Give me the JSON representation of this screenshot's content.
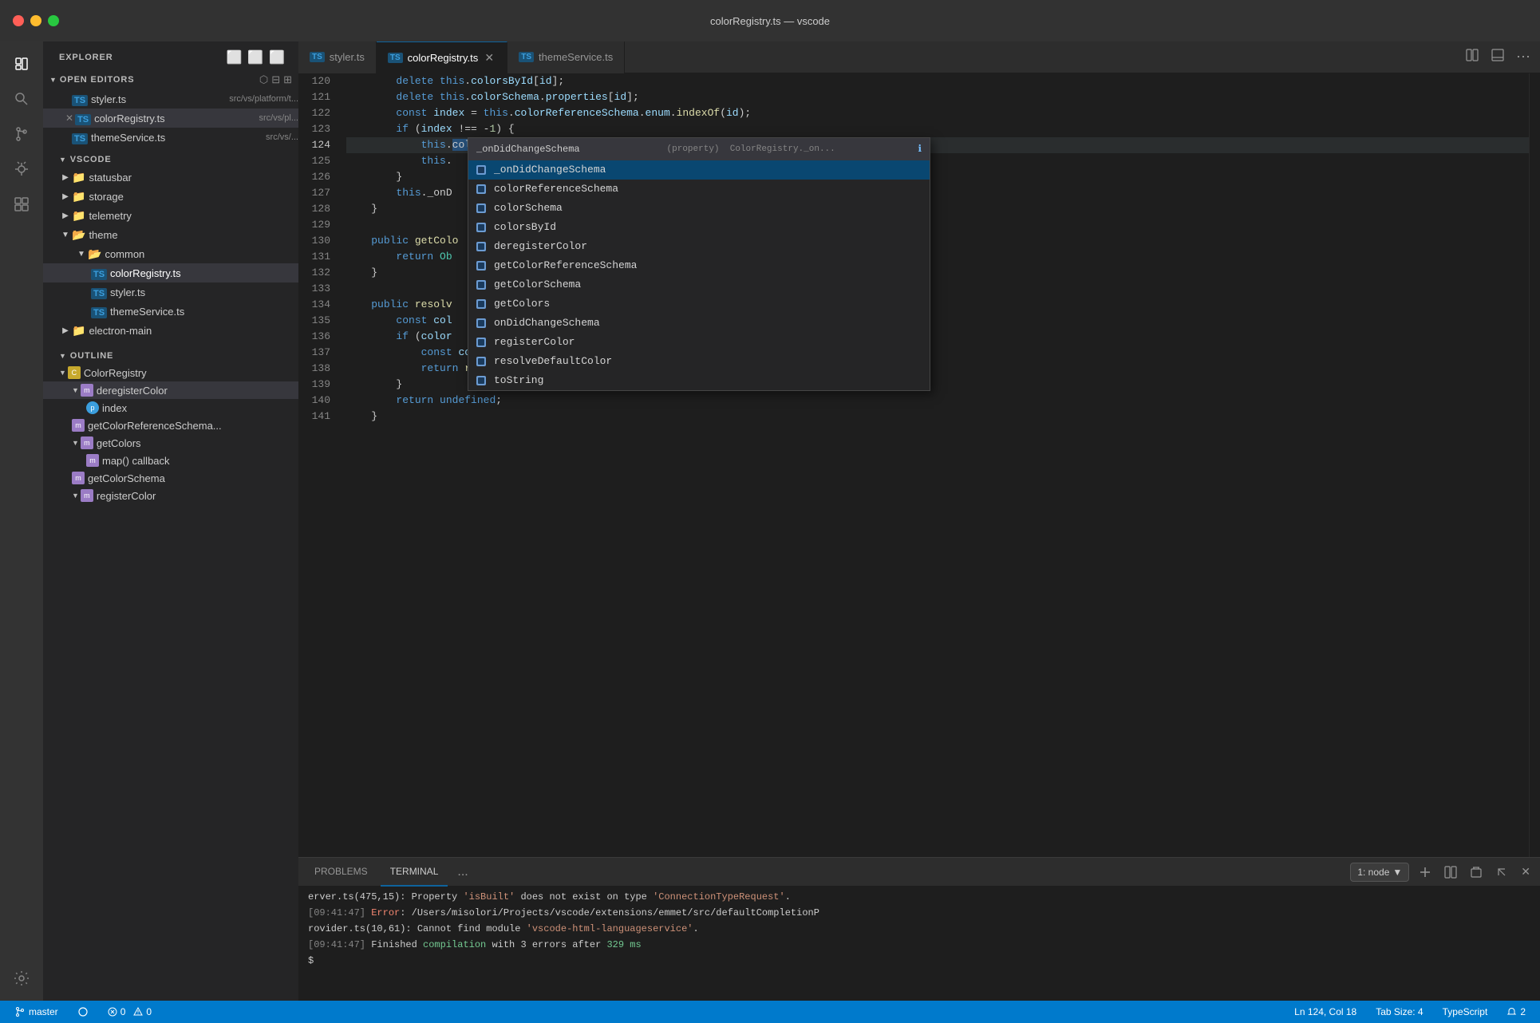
{
  "window": {
    "title": "colorRegistry.ts — vscode",
    "controls": {
      "close_label": "",
      "minimize_label": "",
      "maximize_label": ""
    }
  },
  "activity_bar": {
    "items": [
      {
        "name": "explorer",
        "icon": "⬜",
        "active": true
      },
      {
        "name": "search",
        "icon": "🔍"
      },
      {
        "name": "source-control",
        "icon": "⑂"
      },
      {
        "name": "debug",
        "icon": "🐛"
      },
      {
        "name": "extensions",
        "icon": "⧉"
      }
    ],
    "bottom": [
      {
        "name": "settings",
        "icon": "⚙"
      }
    ]
  },
  "sidebar": {
    "sections": {
      "open_editors": {
        "title": "OPEN EDITORS",
        "files": [
          {
            "name": "styler.ts",
            "path": "src/vs/platform/t...",
            "type": "ts",
            "active": false,
            "close": false
          },
          {
            "name": "colorRegistry.ts",
            "path": "src/vs/pl...",
            "type": "ts",
            "active": true,
            "close": true
          },
          {
            "name": "themeService.ts",
            "path": "src/vs/...",
            "type": "ts",
            "active": false,
            "close": false
          }
        ]
      },
      "vscode": {
        "title": "VSCODE",
        "tree": [
          {
            "name": "statusbar",
            "type": "folder",
            "depth": 1,
            "expanded": false
          },
          {
            "name": "storage",
            "type": "folder",
            "depth": 1,
            "expanded": false
          },
          {
            "name": "telemetry",
            "type": "folder",
            "depth": 1,
            "expanded": false
          },
          {
            "name": "theme",
            "type": "folder",
            "depth": 1,
            "expanded": true
          },
          {
            "name": "common",
            "type": "folder",
            "depth": 2,
            "expanded": true
          },
          {
            "name": "colorRegistry.ts",
            "type": "ts",
            "depth": 3,
            "active": true
          },
          {
            "name": "styler.ts",
            "type": "ts",
            "depth": 3
          },
          {
            "name": "themeService.ts",
            "type": "ts",
            "depth": 3
          },
          {
            "name": "electron-main",
            "type": "folder",
            "depth": 1,
            "expanded": false
          }
        ]
      },
      "outline": {
        "title": "OUTLINE",
        "items": [
          {
            "name": "ColorRegistry",
            "type": "class",
            "depth": 1,
            "expanded": true
          },
          {
            "name": "deregisterColor",
            "type": "method",
            "depth": 2,
            "expanded": true
          },
          {
            "name": "index",
            "type": "prop",
            "depth": 3
          },
          {
            "name": "getColorReferenceSchema...",
            "type": "method",
            "depth": 2
          },
          {
            "name": "getColors",
            "type": "method",
            "depth": 2,
            "expanded": true
          },
          {
            "name": "map() callback",
            "type": "method",
            "depth": 3
          },
          {
            "name": "getColorSchema",
            "type": "method",
            "depth": 2
          },
          {
            "name": "registerColor",
            "type": "method",
            "depth": 2,
            "expanded": true
          }
        ]
      }
    }
  },
  "tabs": [
    {
      "label": "styler.ts",
      "icon": "TS",
      "active": false,
      "modified": false
    },
    {
      "label": "colorRegistry.ts",
      "icon": "TS",
      "active": true,
      "modified": false
    },
    {
      "label": "themeService.ts",
      "icon": "TS",
      "active": false,
      "modified": false
    }
  ],
  "code": {
    "lines": [
      {
        "num": 120,
        "text": "        delete this.colorsById[id];"
      },
      {
        "num": 121,
        "text": "        delete this.colorSchema.properties[id];"
      },
      {
        "num": 122,
        "text": "        const index = this.colorReferenceSchema.enum.indexOf(id);"
      },
      {
        "num": 123,
        "text": "        if (index !== -1) {"
      },
      {
        "num": 124,
        "text": "            this.colorReferenceSchema.enum.splice(index, 1);",
        "highlighted": true
      },
      {
        "num": 125,
        "text": "            this."
      },
      {
        "num": 126,
        "text": "        }"
      },
      {
        "num": 127,
        "text": "        this._onD"
      },
      {
        "num": 128,
        "text": "    }"
      },
      {
        "num": 129,
        "text": ""
      },
      {
        "num": 130,
        "text": "    public getColo"
      },
      {
        "num": 131,
        "text": "        return Ob"
      },
      {
        "num": 132,
        "text": "    }"
      },
      {
        "num": 133,
        "text": ""
      },
      {
        "num": 134,
        "text": "    public resolv"
      },
      {
        "num": 135,
        "text": "        const col"
      },
      {
        "num": 136,
        "text": "        if (color"
      },
      {
        "num": 137,
        "text": "            const colorValue = colorDesc.defaults[theme.type];"
      },
      {
        "num": 138,
        "text": "            return resolveColorValue(colorValue, theme);"
      },
      {
        "num": 139,
        "text": "        }"
      },
      {
        "num": 140,
        "text": "        return undefined;"
      },
      {
        "num": 141,
        "text": "    }"
      }
    ]
  },
  "autocomplete": {
    "header_text": "_onDidChangeSchema",
    "header_detail": "(property)  ColorRegistry._on...",
    "header_info": "ℹ",
    "items": [
      {
        "label": "_onDidChangeSchema",
        "type": "cube",
        "selected": true
      },
      {
        "label": "colorReferenceSchema",
        "type": "cube"
      },
      {
        "label": "colorSchema",
        "type": "cube"
      },
      {
        "label": "colorsById",
        "type": "cube"
      },
      {
        "label": "deregisterColor",
        "type": "cube"
      },
      {
        "label": "getColorReferenceSchema",
        "type": "cube"
      },
      {
        "label": "getColorSchema",
        "type": "cube"
      },
      {
        "label": "getColors",
        "type": "cube"
      },
      {
        "label": "onDidChangeSchema",
        "type": "cube"
      },
      {
        "label": "registerColor",
        "type": "cube"
      },
      {
        "label": "resolveDefaultColor",
        "type": "cube"
      },
      {
        "label": "toString",
        "type": "cube"
      }
    ]
  },
  "panel": {
    "tabs": [
      {
        "label": "PROBLEMS"
      },
      {
        "label": "TERMINAL",
        "active": true
      },
      {
        "label": "..."
      }
    ],
    "terminal_selector": "1: node",
    "terminal_lines": [
      {
        "text": "erver.ts(475,15): Property 'isBuilt' does not exist on type 'ConnectionTypeRequest'."
      },
      {
        "text": "[09:41:47] Error: /Users/misolori/Projects/vscode/extensions/emmet/src/defaultCompletionP",
        "type": "error_prefix",
        "prefix": "[09:41:47] Error: "
      },
      {
        "text": "rovider.ts(10,61): Cannot find module 'vscode-html-languageservice'."
      },
      {
        "text": "[09:41:47] Finished compilation with 3 errors after 329 ms",
        "type": "mixed"
      }
    ],
    "prompt": "$ "
  },
  "statusbar": {
    "left": [
      {
        "label": " master",
        "icon": "git"
      },
      {
        "label": "⟳"
      },
      {
        "label": "⊗ 0  ⚠ 0"
      }
    ],
    "right": [
      {
        "label": "Ln 124, Col 18"
      },
      {
        "label": "Tab Size: 4"
      },
      {
        "label": "TypeScript"
      },
      {
        "label": "🔔 2"
      }
    ]
  }
}
